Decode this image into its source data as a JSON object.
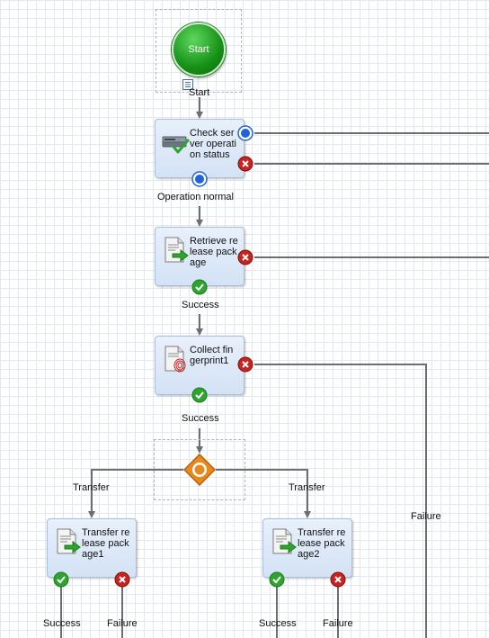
{
  "start": {
    "label": "Start",
    "caption": "Start"
  },
  "nodes": [
    {
      "id": "check-server",
      "label": "Check ser\nver operati\non status",
      "icon": "server-check-icon"
    },
    {
      "id": "retrieve-package",
      "label": "Retrieve re\nlease pack\nage",
      "icon": "document-arrow-icon"
    },
    {
      "id": "collect-fingerprint",
      "label": "Collect fin\ngerprint1",
      "icon": "document-fingerprint-icon"
    },
    {
      "id": "transfer-package-1",
      "label": "Transfer re\nlease pack\nage1",
      "icon": "document-arrow-icon"
    },
    {
      "id": "transfer-package-2",
      "label": "Transfer re\nlease pack\nage2",
      "icon": "document-arrow-icon"
    }
  ],
  "connection_labels": {
    "operation_normal": "Operation normal",
    "success_retrieve": "Success",
    "success_collect": "Success",
    "transfer_left": "Transfer",
    "transfer_right": "Transfer",
    "failure_collect": "Failure",
    "success_t1": "Success",
    "failure_t1": "Failure",
    "success_t2": "Success",
    "failure_t2": "Failure"
  },
  "colors": {
    "start_green": "#169016",
    "node_fill": "#dce8f8",
    "node_border": "#a9bfd8",
    "port_blue": "#1f63d8",
    "port_green": "#2ea52e",
    "port_red": "#c8231f",
    "gateway_orange": "#e8891e",
    "wire": "#6e6e6e"
  }
}
